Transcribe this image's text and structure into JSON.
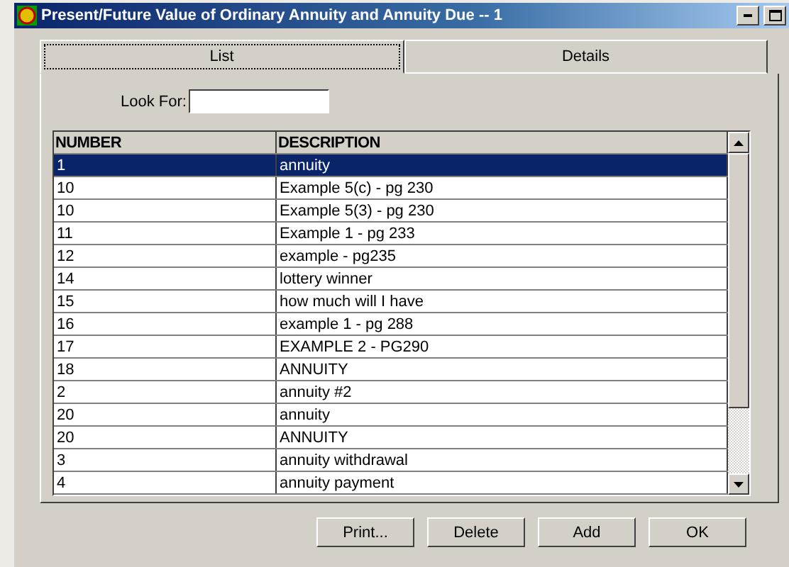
{
  "window": {
    "title": "Present/Future Value of Ordinary Annuity and Annuity Due -- 1"
  },
  "tabs": [
    {
      "label": "List",
      "selected": true
    },
    {
      "label": "Details",
      "selected": false
    }
  ],
  "search": {
    "label": "Look For:"
  },
  "table": {
    "columns": [
      "NUMBER",
      "DESCRIPTION"
    ],
    "rows": [
      {
        "cells": [
          "1",
          "annuity"
        ],
        "selected": true
      },
      {
        "cells": [
          "10",
          "Example 5(c) - pg 230"
        ],
        "selected": false
      },
      {
        "cells": [
          "10",
          "Example 5(3) - pg 230"
        ],
        "selected": false
      },
      {
        "cells": [
          "11",
          "Example 1 - pg 233"
        ],
        "selected": false
      },
      {
        "cells": [
          "12",
          "example - pg235"
        ],
        "selected": false
      },
      {
        "cells": [
          "14",
          "lottery winner"
        ],
        "selected": false
      },
      {
        "cells": [
          "15",
          "how much will I have"
        ],
        "selected": false
      },
      {
        "cells": [
          "16",
          "example 1 - pg 288"
        ],
        "selected": false
      },
      {
        "cells": [
          "17",
          "EXAMPLE 2 - PG290"
        ],
        "selected": false
      },
      {
        "cells": [
          "18",
          "ANNUITY"
        ],
        "selected": false
      },
      {
        "cells": [
          "2",
          "annuity #2"
        ],
        "selected": false
      },
      {
        "cells": [
          "20",
          "annuity"
        ],
        "selected": false
      },
      {
        "cells": [
          "20",
          "ANNUITY"
        ],
        "selected": false
      },
      {
        "cells": [
          "3",
          "annuity withdrawal"
        ],
        "selected": false
      },
      {
        "cells": [
          "4",
          "annuity payment"
        ],
        "selected": false
      }
    ]
  },
  "buttons": [
    "Print...",
    "Delete",
    "Add",
    "OK"
  ]
}
